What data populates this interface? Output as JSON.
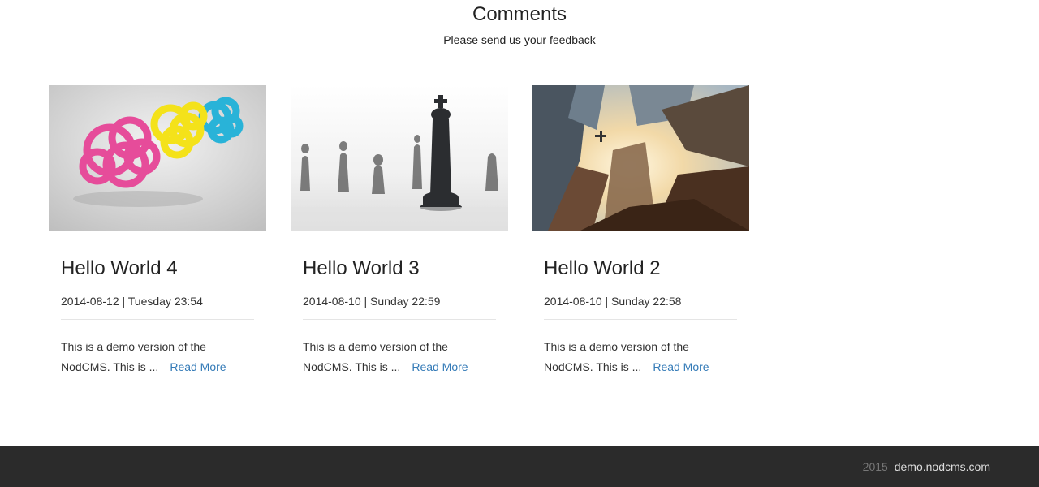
{
  "section": {
    "title": "Comments",
    "subtitle": "Please send us your feedback"
  },
  "posts": [
    {
      "title": "Hello World 4",
      "date": "2014-08-12 | Tuesday 23:54",
      "excerpt_line1": "This is a demo version of the",
      "excerpt_line2": "NodCMS. This is ...",
      "read_more": "Read More",
      "image": "colorful-knotted-balls-image"
    },
    {
      "title": "Hello World 3",
      "date": "2014-08-10 | Sunday 22:59",
      "excerpt_line1": "This is a demo version of the",
      "excerpt_line2": "NodCMS. This is ...",
      "read_more": "Read More",
      "image": "chess-pieces-image"
    },
    {
      "title": "Hello World 2",
      "date": "2014-08-10 | Sunday 22:58",
      "excerpt_line1": "This is a demo version of the",
      "excerpt_line2": "NodCMS. This is ...",
      "read_more": "Read More",
      "image": "skyscrapers-airplane-image"
    }
  ],
  "footer": {
    "year": "2015",
    "site": "demo.nodcms.com"
  },
  "colors": {
    "link": "#337ab7",
    "footer_bg": "#2b2b2b",
    "text": "#333333"
  }
}
